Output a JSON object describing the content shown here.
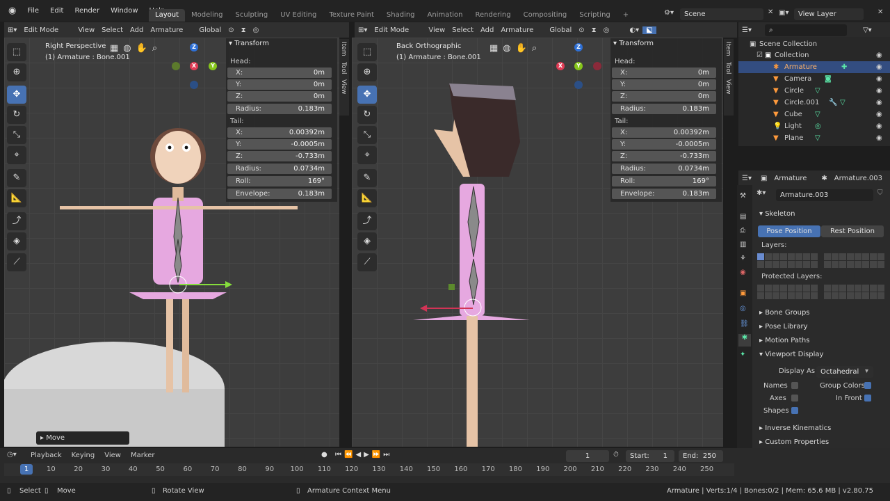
{
  "menu": [
    "File",
    "Edit",
    "Render",
    "Window",
    "Help"
  ],
  "workspaces": [
    "Layout",
    "Modeling",
    "Sculpting",
    "UV Editing",
    "Texture Paint",
    "Shading",
    "Animation",
    "Rendering",
    "Compositing",
    "Scripting"
  ],
  "scene": {
    "name": "Scene",
    "view_layer": "View Layer"
  },
  "left_view": {
    "mode": "Edit Mode",
    "menus": [
      "View",
      "Select",
      "Add",
      "Armature"
    ],
    "orientation": "Global",
    "title": "Right Perspective",
    "subtitle": "(1) Armature : Bone.001"
  },
  "right_view": {
    "mode": "Edit Mode",
    "menus": [
      "View",
      "Select",
      "Add",
      "Armature"
    ],
    "orientation": "Global",
    "title": "Back Orthographic",
    "subtitle": "(1) Armature : Bone.001"
  },
  "transform": {
    "title": "Transform",
    "head_label": "Head:",
    "tail_label": "Tail:",
    "head": [
      {
        "k": "X:",
        "v": "0m"
      },
      {
        "k": "Y:",
        "v": "0m"
      },
      {
        "k": "Z:",
        "v": "0m"
      }
    ],
    "head_radius": {
      "k": "Radius:",
      "v": "0.183m"
    },
    "tail": [
      {
        "k": "X:",
        "v": "0.00392m"
      },
      {
        "k": "Y:",
        "v": "-0.0005m"
      },
      {
        "k": "Z:",
        "v": "-0.733m"
      }
    ],
    "tail_radius": {
      "k": "Radius:",
      "v": "0.0734m"
    },
    "roll": {
      "k": "Roll:",
      "v": "169°"
    },
    "envelope": {
      "k": "Envelope:",
      "v": "0.183m"
    }
  },
  "side_tabs": [
    "Item",
    "Tool",
    "View"
  ],
  "axis": {
    "x": "X",
    "y": "Y",
    "z": "Z"
  },
  "move_panel": "Move",
  "outliner": {
    "root": "Scene Collection",
    "collection": "Collection",
    "items": [
      "Armature",
      "Camera",
      "Circle",
      "Circle.001",
      "Cube",
      "Light",
      "Plane"
    ]
  },
  "properties": {
    "object": "Armature",
    "data": "Armature.003",
    "data_field": "Armature.003",
    "skeleton": "Skeleton",
    "pose_position": "Pose Position",
    "rest_position": "Rest Position",
    "layers": "Layers:",
    "protected_layers": "Protected Layers:",
    "bone_groups": "Bone Groups",
    "pose_library": "Pose Library",
    "motion_paths": "Motion Paths",
    "viewport_display": "Viewport Display",
    "display_as_label": "Display As",
    "display_as": "Octahedral",
    "names": "Names",
    "axes": "Axes",
    "shapes": "Shapes",
    "group_colors": "Group Colors",
    "in_front": "In Front",
    "inverse_kinematics": "Inverse Kinematics",
    "custom_properties": "Custom Properties"
  },
  "timeline": {
    "menus": [
      "Playback",
      "Keying",
      "View",
      "Marker"
    ],
    "current": "1",
    "start_label": "Start:",
    "start": "1",
    "end_label": "End:",
    "end": "250",
    "ticks": [
      "1",
      "10",
      "20",
      "30",
      "40",
      "50",
      "60",
      "70",
      "80",
      "90",
      "100",
      "110",
      "120",
      "130",
      "140",
      "150",
      "160",
      "170",
      "180",
      "190",
      "200",
      "210",
      "220",
      "230",
      "240",
      "250"
    ]
  },
  "status": {
    "select": "Select",
    "move": "Move",
    "rotate": "Rotate View",
    "context": "Armature Context Menu",
    "info": "Armature | Verts:1/4 | Bones:0/2 | Mem: 65.6 MB | v2.80.75"
  }
}
